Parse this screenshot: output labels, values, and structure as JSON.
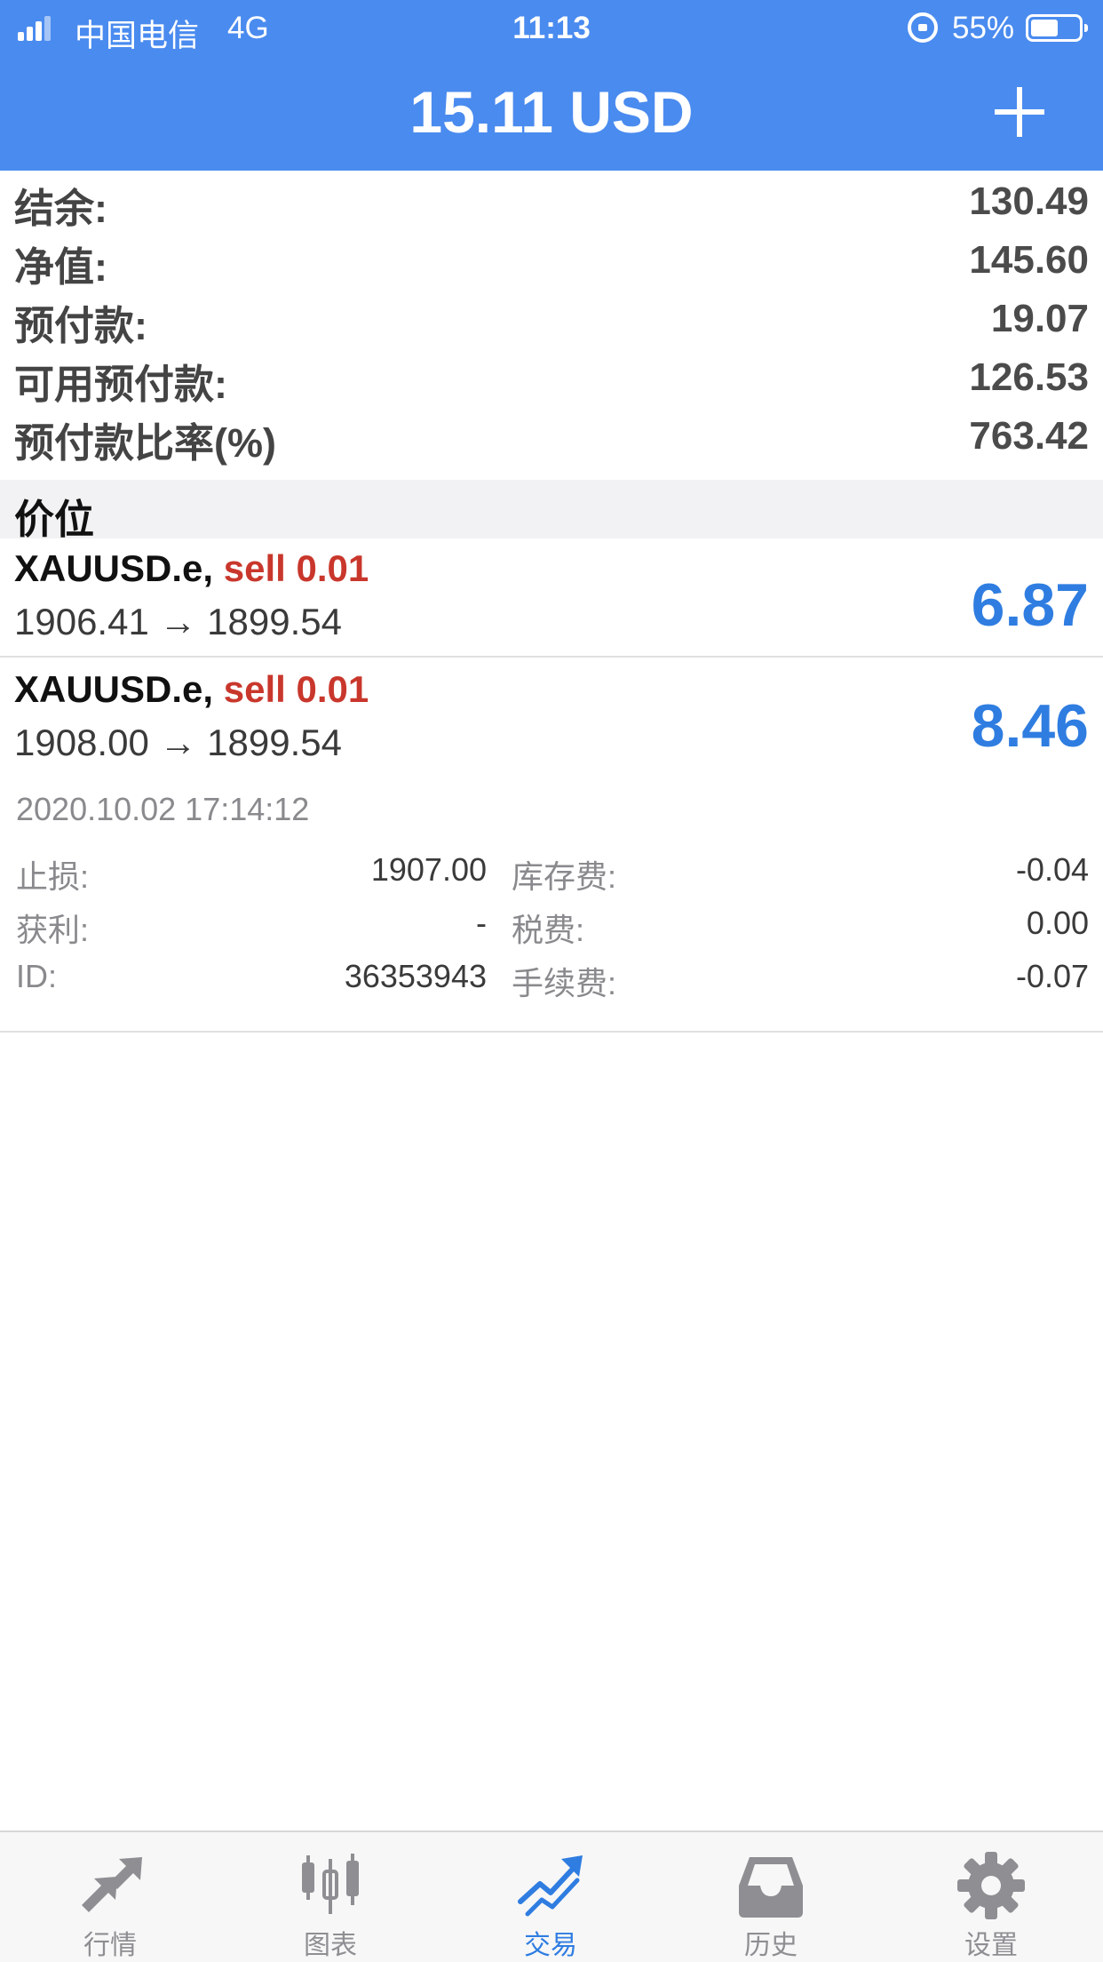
{
  "status_bar": {
    "carrier": "中国电信",
    "network": "4G",
    "time": "11:13",
    "battery": "55%"
  },
  "header": {
    "title": "15.11 USD"
  },
  "account": [
    {
      "label": "结余:",
      "value": "130.49"
    },
    {
      "label": "净值:",
      "value": "145.60"
    },
    {
      "label": "预付款:",
      "value": "19.07"
    },
    {
      "label": "可用预付款:",
      "value": "126.53"
    },
    {
      "label": "预付款比率(%)",
      "value": "763.42"
    }
  ],
  "section_title": "价位",
  "positions": [
    {
      "symbol": "XAUUSD.e,",
      "side": "sell 0.01",
      "prices": "1906.41 → 1899.54",
      "profit": "6.87"
    },
    {
      "symbol": "XAUUSD.e,",
      "side": "sell 0.01",
      "prices": "1908.00 → 1899.54",
      "profit": "8.46"
    }
  ],
  "position_detail": {
    "time": "2020.10.02 17:14:12",
    "rows": [
      {
        "k1": "止损:",
        "v1": "1907.00",
        "k2": "库存费:",
        "v2": "-0.04"
      },
      {
        "k1": "获利:",
        "v1": "-",
        "k2": "税费:",
        "v2": "0.00"
      },
      {
        "k1": "ID:",
        "v1": "36353943",
        "k2": "手续费:",
        "v2": "-0.07"
      }
    ]
  },
  "tabs": [
    {
      "label": "行情",
      "icon": "quotes-arrows-icon",
      "active": false
    },
    {
      "label": "图表",
      "icon": "candlestick-chart-icon",
      "active": false
    },
    {
      "label": "交易",
      "icon": "trade-trend-icon",
      "active": true
    },
    {
      "label": "历史",
      "icon": "history-inbox-icon",
      "active": false
    },
    {
      "label": "设置",
      "icon": "settings-gear-icon",
      "active": false
    }
  ],
  "colors": {
    "header_blue": "#4a8bef",
    "profit_blue": "#2f7de1",
    "sell_red": "#c9372c",
    "tab_inactive": "#8e8e93"
  }
}
